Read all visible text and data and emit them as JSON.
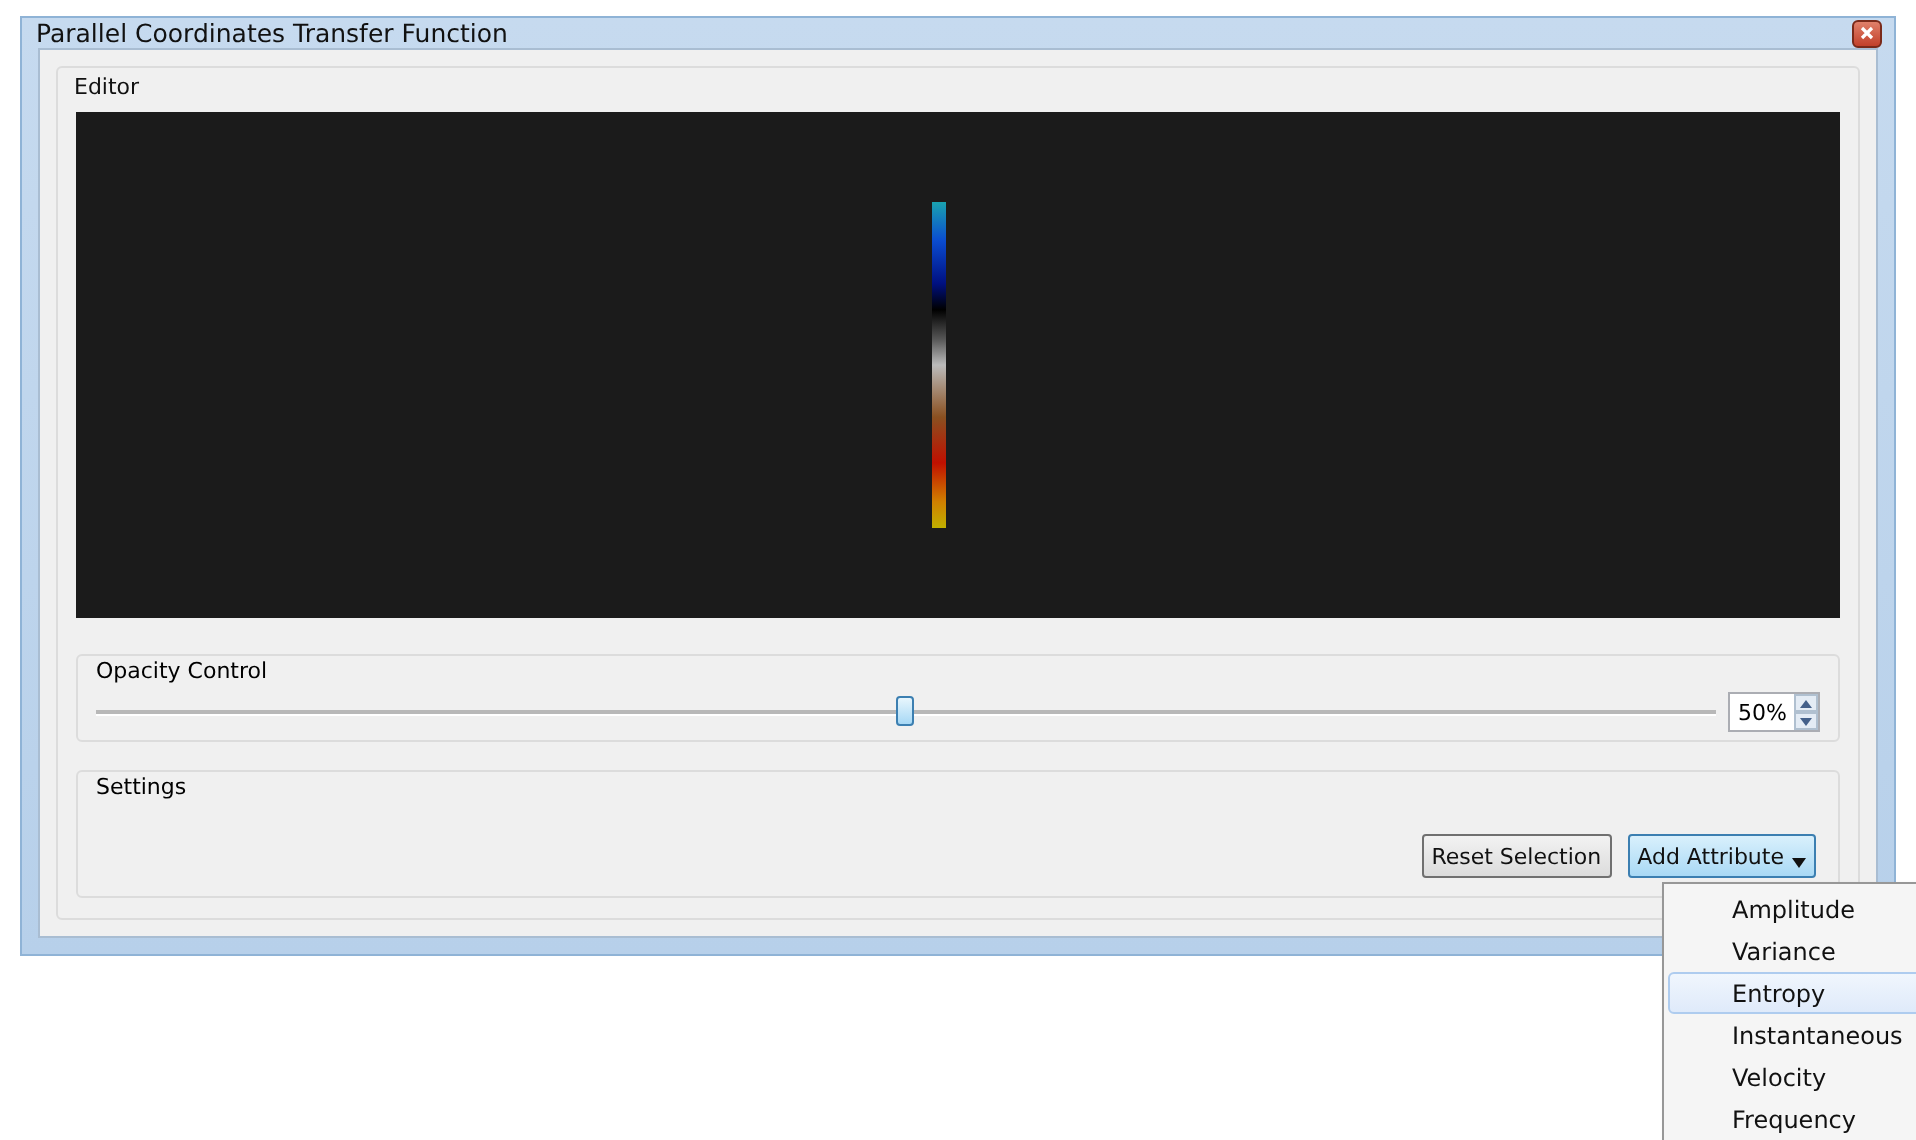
{
  "window": {
    "title": "Parallel Coordinates Transfer Function"
  },
  "editor": {
    "title": "Editor"
  },
  "opacity_control": {
    "title": "Opacity Control",
    "level": 0.5,
    "value": "50%"
  },
  "settings": {
    "title": "Settings",
    "buttons": [
      {
        "label": "Reset Selection",
        "kind": "plain"
      },
      {
        "label": "Add Attribute",
        "kind": "dropdown",
        "expanded": true
      }
    ]
  },
  "menu": {
    "items": [
      {
        "label": "Amplitude",
        "selected": false
      },
      {
        "label": "Variance",
        "selected": false
      },
      {
        "label": "Entropy",
        "selected": true
      },
      {
        "label": "Instantaneous",
        "selected": false
      },
      {
        "label": "Velocity",
        "selected": false
      },
      {
        "label": "Frequency",
        "selected": false
      }
    ]
  }
}
